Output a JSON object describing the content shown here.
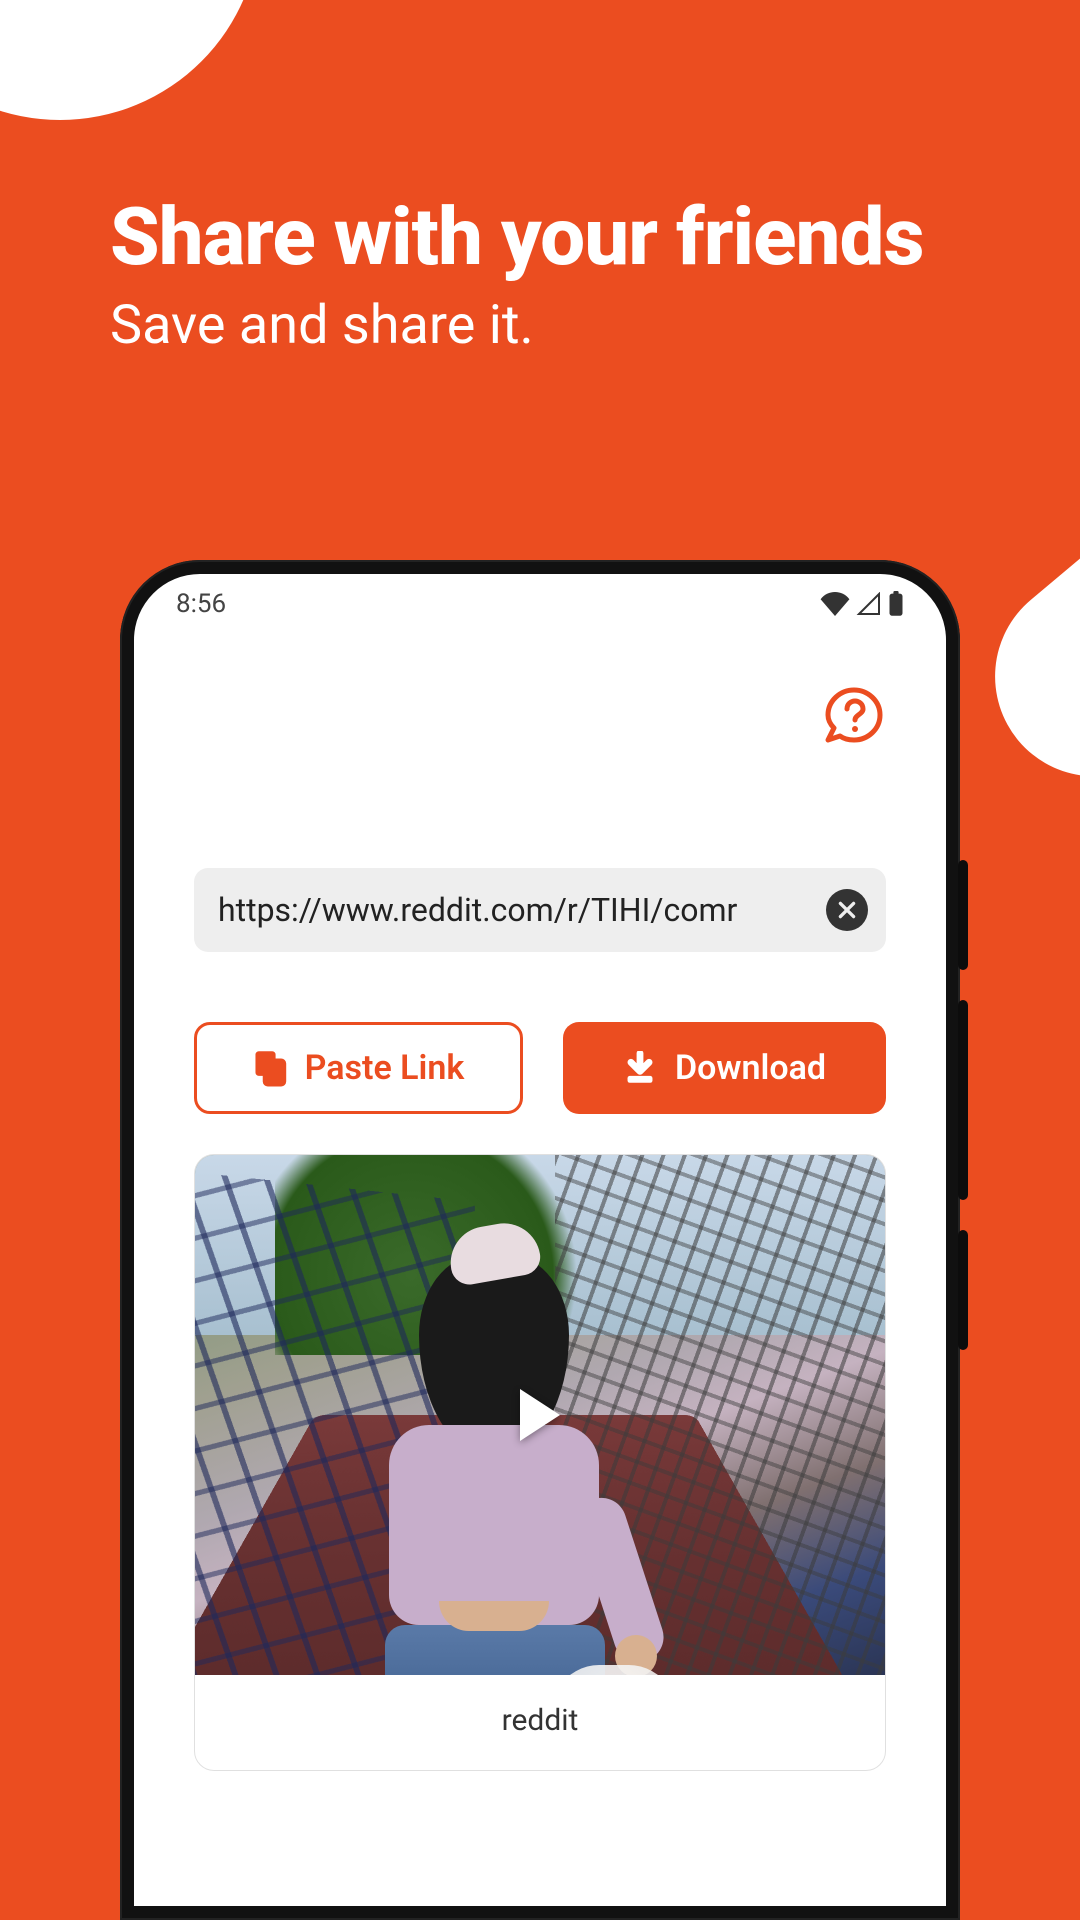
{
  "hero": {
    "title": "Share with your friends",
    "subtitle": "Save and share it."
  },
  "statusbar": {
    "time": "8:56"
  },
  "app": {
    "url_value": "https://www.reddit.com/r/TIHI/comr",
    "paste_label": "Paste Link",
    "download_label": "Download",
    "card_caption": "reddit"
  },
  "colors": {
    "accent": "#eb4d20"
  }
}
